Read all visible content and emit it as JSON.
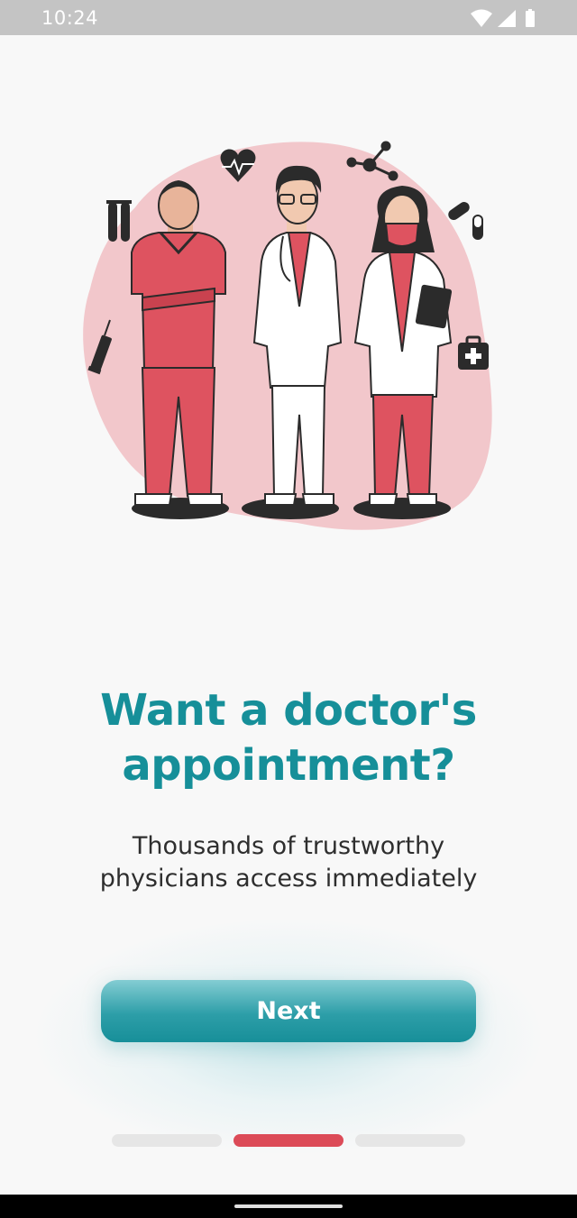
{
  "status_bar": {
    "time": "10:24",
    "icons": [
      "wifi-icon",
      "signal-icon",
      "battery-icon"
    ]
  },
  "onboarding": {
    "title_line1": "Want a doctor's",
    "title_line2": "appointment?",
    "subtitle_line1": "Thousands of trustworthy",
    "subtitle_line2": "physicians access immediately",
    "next_label": "Next",
    "pages_total": 3,
    "current_page": 2
  },
  "colors": {
    "accent_teal": "#168f99",
    "accent_red": "#dc4b58",
    "blob_pink": "#f2c7cb",
    "scrubs_red": "#de5360",
    "background": "#f8f8f8"
  }
}
